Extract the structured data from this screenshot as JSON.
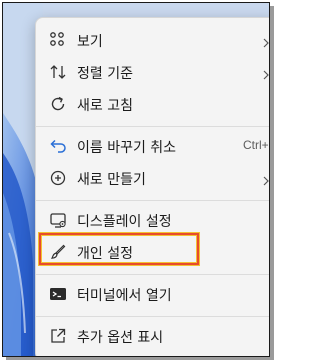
{
  "context_menu": {
    "items": [
      {
        "label": "보기",
        "icon": "grid-icon",
        "submenu": true
      },
      {
        "label": "정렬 기준",
        "icon": "sort-arrows-icon",
        "submenu": true
      },
      {
        "label": "새로 고침",
        "icon": "refresh-icon"
      },
      {
        "label": "이름 바꾸기 취소",
        "icon": "undo-icon",
        "shortcut": "Ctrl+Z"
      },
      {
        "label": "새로 만들기",
        "icon": "add-circle-icon",
        "submenu": true
      },
      {
        "label": "디스플레이 설정",
        "icon": "display-settings-icon"
      },
      {
        "label": "개인 설정",
        "icon": "brush-icon",
        "highlighted": true
      },
      {
        "label": "터미널에서 열기",
        "icon": "terminal-icon"
      },
      {
        "label": "추가 옵션 표시",
        "icon": "open-external-icon"
      }
    ]
  },
  "colors": {
    "menu_bg": "#f4f4f4",
    "highlight_outline": "#e84b2c",
    "highlight_glow": "#f2c230",
    "wallpaper_blue": "#2f6fe0"
  }
}
